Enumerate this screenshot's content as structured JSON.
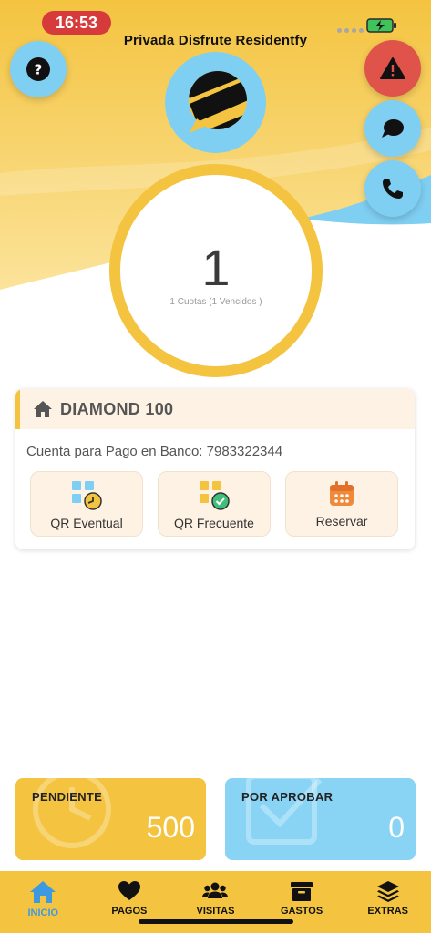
{
  "status_bar": {
    "time": "16:53"
  },
  "app": {
    "title": "Privada Disfrute Residentfy"
  },
  "buttons": {
    "help_icon": "question-icon",
    "alert_icon": "warning-icon",
    "chat_icon": "chat-icon",
    "phone_icon": "phone-icon"
  },
  "summary": {
    "count": "1",
    "description": "1 Cuotas (1 Vencidos )"
  },
  "unit": {
    "name": "DIAMOND 100",
    "bank_account": "Cuenta para Pago en Banco: 7983322344",
    "actions": [
      {
        "label": "QR Eventual",
        "icon": "qr-clock-icon"
      },
      {
        "label": "QR Frecuente",
        "icon": "qr-check-icon"
      },
      {
        "label": "Reservar",
        "icon": "calendar-icon"
      }
    ]
  },
  "stats": {
    "pending": {
      "label": "PENDIENTE",
      "value": "500"
    },
    "to_approve": {
      "label": "POR APROBAR",
      "value": "0"
    }
  },
  "nav": [
    {
      "label": "INICIO",
      "icon": "home-icon",
      "active": true
    },
    {
      "label": "PAGOS",
      "icon": "heart-icon",
      "active": false
    },
    {
      "label": "VISITAS",
      "icon": "users-icon",
      "active": false
    },
    {
      "label": "GASTOS",
      "icon": "archive-icon",
      "active": false
    },
    {
      "label": "EXTRAS",
      "icon": "layers-icon",
      "active": false
    }
  ],
  "colors": {
    "primary_yellow": "#f4c440",
    "accent_blue": "#7fcff3",
    "alert_red": "#e0534a",
    "active_nav": "#3d9ae0"
  }
}
